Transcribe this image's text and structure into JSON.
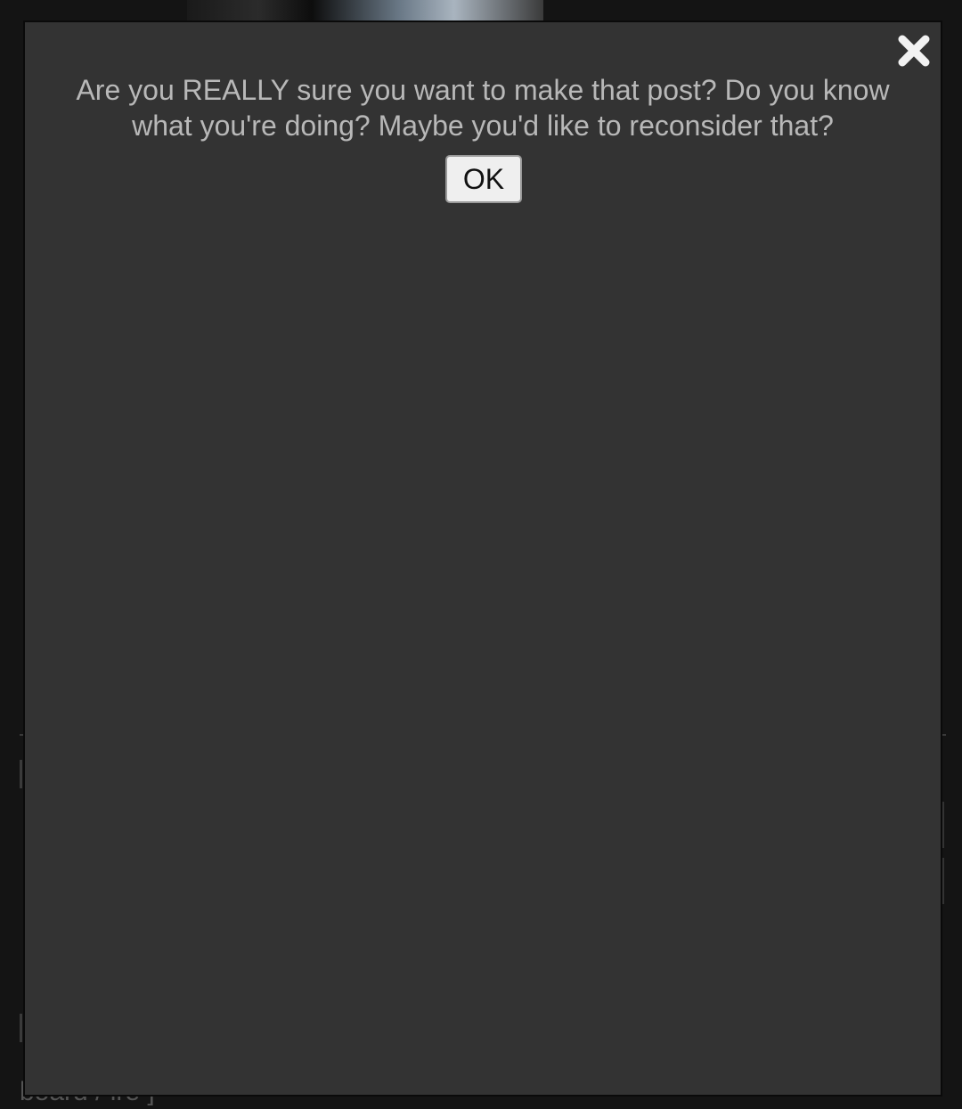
{
  "dialog": {
    "message": "Are you REALLY sure you want to make that post? Do you know what you're doing? Maybe you'd like to reconsider that?",
    "ok_label": "OK",
    "close_icon": "close-icon"
  },
  "background": {
    "footer_text": "board / ire ]"
  },
  "colors": {
    "modal_bg": "#333333",
    "page_bg": "#141414",
    "message_text": "#b8b8b8",
    "button_bg": "#efefef"
  }
}
